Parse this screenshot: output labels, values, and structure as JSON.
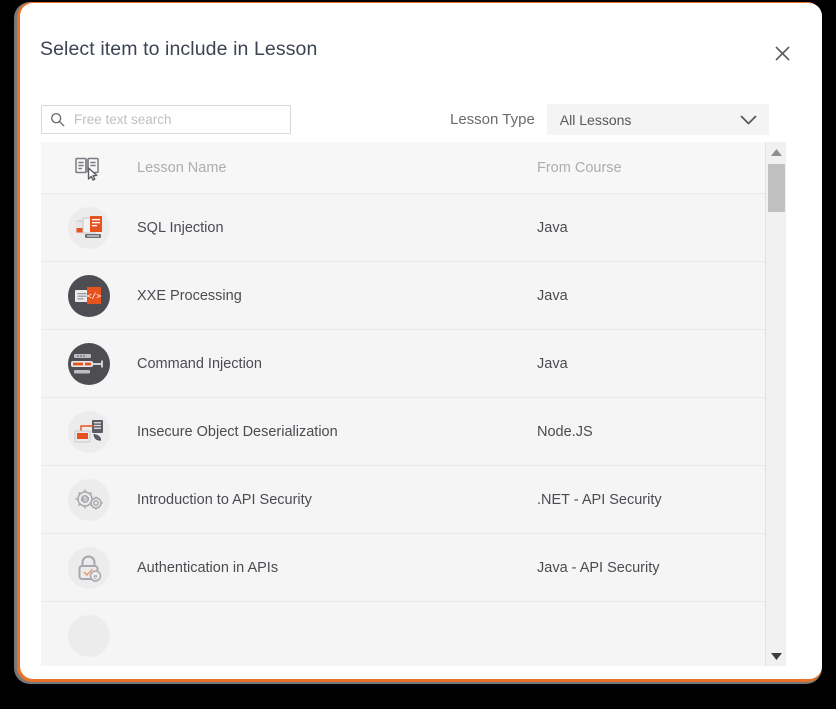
{
  "dialog": {
    "title": "Select item to include in Lesson",
    "close_icon": "close-icon"
  },
  "toolbar": {
    "search": {
      "placeholder": "Free text search",
      "value": "",
      "icon": "search-icon"
    },
    "filter": {
      "label": "Lesson Type",
      "selected": "All Lessons",
      "chevron_icon": "chevron-down-icon"
    }
  },
  "list": {
    "header": {
      "icon": "book-cursor-icon",
      "name_column": "Lesson Name",
      "course_column": "From Course"
    },
    "rows": [
      {
        "icon": "sql-injection-icon",
        "icon_style": "light",
        "name": "SQL Injection",
        "course": "Java"
      },
      {
        "icon": "xxe-processing-icon",
        "icon_style": "dark",
        "name": "XXE Processing",
        "course": "Java"
      },
      {
        "icon": "command-injection-icon",
        "icon_style": "dark",
        "name": "Command Injection",
        "course": "Java"
      },
      {
        "icon": "deserialization-icon",
        "icon_style": "light",
        "name": "Insecure Object Deserialization",
        "course": "Node.JS"
      },
      {
        "icon": "gears-api-icon",
        "icon_style": "light",
        "name": "Introduction to API Security",
        "course": ".NET - API Security"
      },
      {
        "icon": "padlock-icon",
        "icon_style": "light",
        "name": "Authentication in APIs",
        "course": "Java - API Security"
      },
      {
        "icon": "partial-icon",
        "icon_style": "light",
        "name": "",
        "course": ""
      }
    ]
  },
  "scrollbar": {
    "up_icon": "scroll-up-arrow-icon",
    "down_icon": "scroll-down-arrow-icon",
    "thumb": "scrollbar-thumb"
  },
  "colors": {
    "focus_ring": "#e8742c",
    "accent_orange": "#e8521e",
    "row_bg": "#f5f5f6",
    "text": "#4b4b52",
    "muted_text": "#adadb2"
  }
}
